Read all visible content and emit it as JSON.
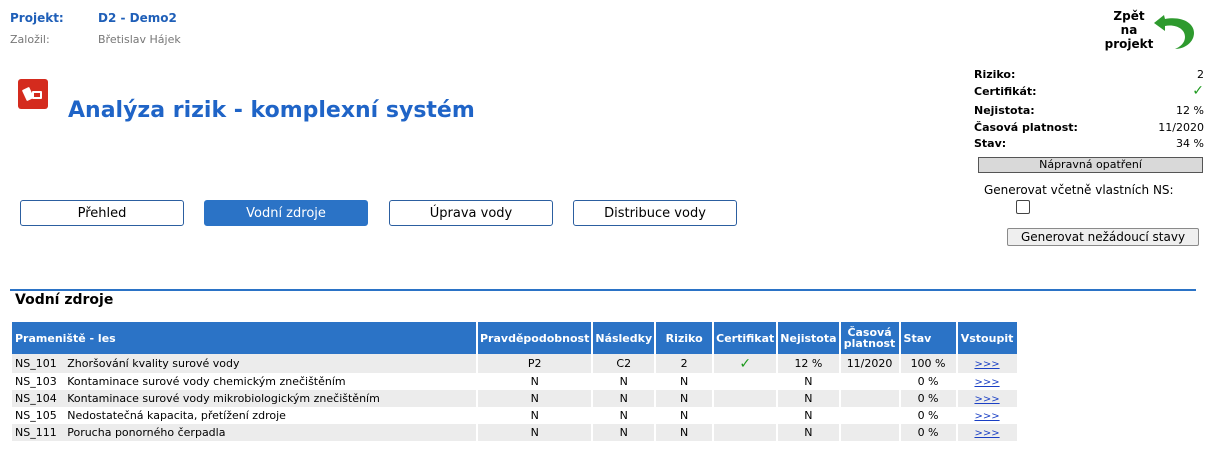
{
  "header": {
    "project_label": "Projekt:",
    "project_value": "D2 - Demo2",
    "founder_label": "Založil:",
    "founder_value": "Břetislav Hájek"
  },
  "back": {
    "label_line1": "Zpět na",
    "label_line2": "projekt",
    "icon": "back-arrow-icon",
    "icon_color": "#2e9a2e"
  },
  "title": "Analýza rizik - komplexní systém",
  "tabs": [
    {
      "label": "Přehled",
      "active": false
    },
    {
      "label": "Vodní zdroje",
      "active": true
    },
    {
      "label": "Úprava vody",
      "active": false
    },
    {
      "label": "Distribuce vody",
      "active": false
    }
  ],
  "summary": {
    "riziko_label": "Riziko:",
    "riziko_value": "2",
    "certifikat_label": "Certifikát:",
    "nejistota_label": "Nejistota:",
    "nejistota_value": "12 %",
    "platnost_label": "Časová platnost:",
    "platnost_value": "11/2020",
    "stav_label": "Stav:",
    "stav_value": "34 %",
    "stav_progress": 0.34,
    "napravna_label": "Nápravná opatření",
    "generovat_label": "Generovat včetně vlastních NS:",
    "generovat_button": "Generovat nežádoucí stavy"
  },
  "section": {
    "title": "Vodní zdroje",
    "columns": [
      "Prameniště - les",
      "Pravděpodobnost",
      "Následky",
      "Riziko",
      "Certifikat",
      "Nejistota",
      "Časová platnost",
      "Stav",
      "Vstoupit"
    ],
    "rows": [
      {
        "code": "NS_101",
        "desc": "Zhoršování kvality surové vody",
        "prob": "P2",
        "nasl": "C2",
        "riziko": "2",
        "cert": "✓",
        "nejistota": "12 %",
        "platnost": "11/2020",
        "stav": "100 %",
        "link": ">>>"
      },
      {
        "code": "NS_103",
        "desc": "Kontaminace surové vody chemickým znečištěním",
        "prob": "N",
        "nasl": "N",
        "riziko": "N",
        "cert": "",
        "nejistota": "N",
        "platnost": "",
        "stav": "0 %",
        "link": ">>>"
      },
      {
        "code": "NS_104",
        "desc": "Kontaminace surové vody mikrobiologickým znečištěním",
        "prob": "N",
        "nasl": "N",
        "riziko": "N",
        "cert": "",
        "nejistota": "N",
        "platnost": "",
        "stav": "0 %",
        "link": ">>>"
      },
      {
        "code": "NS_105",
        "desc": "Nedostatečná kapacita, přetížení zdroje",
        "prob": "N",
        "nasl": "N",
        "riziko": "N",
        "cert": "",
        "nejistota": "N",
        "platnost": "",
        "stav": "0 %",
        "link": ">>>"
      },
      {
        "code": "NS_111",
        "desc": "Porucha ponorného čerpadla",
        "prob": "N",
        "nasl": "N",
        "riziko": "N",
        "cert": "",
        "nejistota": "N",
        "platnost": "",
        "stav": "0 %",
        "link": ">>>"
      }
    ]
  }
}
